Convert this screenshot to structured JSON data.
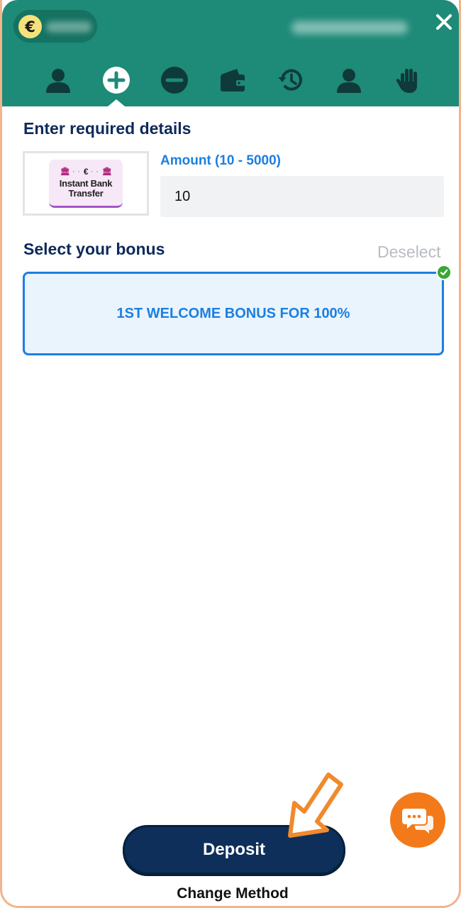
{
  "header": {
    "currency_symbol": "€",
    "tabs": [
      {
        "name": "profile",
        "icon": "user-icon"
      },
      {
        "name": "deposit",
        "icon": "plus-circle-icon",
        "active": true
      },
      {
        "name": "withdraw",
        "icon": "minus-circle-icon"
      },
      {
        "name": "wallet",
        "icon": "wallet-icon"
      },
      {
        "name": "history",
        "icon": "history-icon"
      },
      {
        "name": "account",
        "icon": "user-icon"
      },
      {
        "name": "responsible-gaming",
        "icon": "hand-icon"
      }
    ],
    "close_icon": "close-icon"
  },
  "details": {
    "title": "Enter required details",
    "method": {
      "logo_line1": "Instant Bank",
      "logo_line2": "Transfer",
      "logo_symbol": "€"
    },
    "amount": {
      "label": "Amount (10 - 5000)",
      "value": "10"
    }
  },
  "bonus": {
    "title": "Select your bonus",
    "deselect_label": "Deselect",
    "selected_option": "1ST WELCOME BONUS FOR 100%"
  },
  "actions": {
    "deposit_label": "Deposit",
    "change_method_label": "Change Method"
  },
  "colors": {
    "header_bg": "#1e8a78",
    "accent_blue": "#1c7fe0",
    "navy": "#0d2a5b",
    "chat_orange": "#f27a1b",
    "check_green": "#3aa735"
  }
}
